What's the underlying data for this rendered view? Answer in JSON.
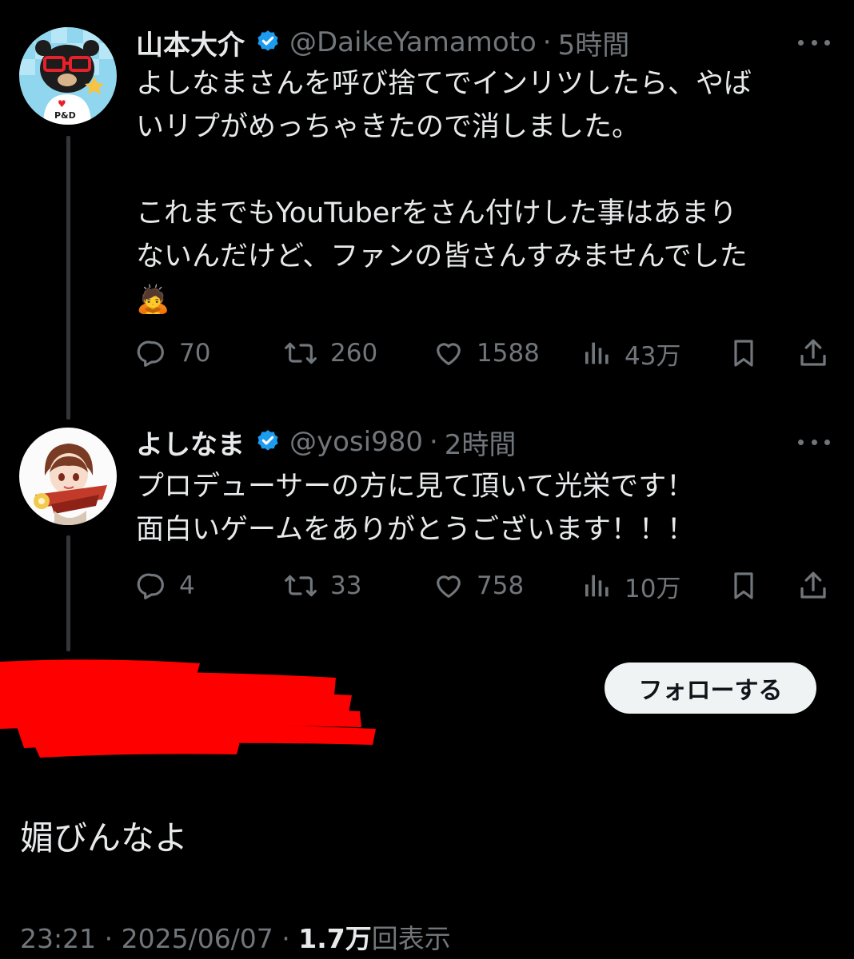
{
  "tweets": [
    {
      "name": "山本大介",
      "handle": "@DaikeYamamoto",
      "separator": "·",
      "time": "5時間",
      "lines": [
        "よしなまさんを呼び捨てでインリツしたら、やば",
        "いリプがめっちゃきたので消しました。",
        "",
        "これまでもYouTuberをさん付けした事はあまり",
        "ないんだけど、ファンの皆さんすみませんでした"
      ],
      "emoji": "🙇",
      "avatar_text": "I ♥ P&D",
      "stats": {
        "replies": "70",
        "retweets": "260",
        "likes": "1588",
        "views": "43万"
      }
    },
    {
      "name": "よしなま",
      "handle": "@yosi980",
      "separator": "·",
      "time": "2時間",
      "lines": [
        "プロデューサーの方に見て頂いて光栄です！",
        "面白いゲームをありがとうございます！！！"
      ],
      "stats": {
        "replies": "4",
        "retweets": "33",
        "likes": "758",
        "views": "10万"
      }
    }
  ],
  "follow_button": "フォローする",
  "reply_text": "媚びんなよ",
  "meta": {
    "time": "23:21",
    "separator": " · ",
    "date": "2025/06/07",
    "views_count": "1.7万",
    "views_label": "回表示"
  },
  "colors": {
    "background": "#000000",
    "text": "#e7e9ea",
    "muted": "#71767b",
    "verified": "#1d9bf0",
    "redaction": "#ff0000"
  },
  "icons": [
    "verified-badge-icon",
    "more-icon",
    "reply-icon",
    "retweet-icon",
    "like-icon",
    "views-icon",
    "bookmark-icon",
    "share-icon"
  ]
}
